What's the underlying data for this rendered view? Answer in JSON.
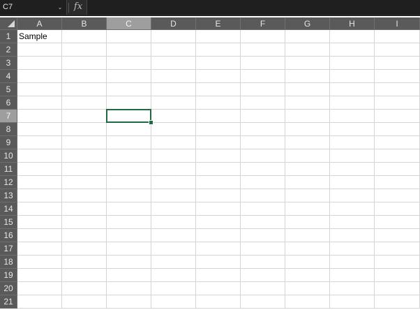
{
  "name_box": {
    "value": "C7",
    "dropdown_glyph": "⌄"
  },
  "formula_bar": {
    "fx_label": "fx",
    "value": ""
  },
  "columns": [
    "A",
    "B",
    "C",
    "D",
    "E",
    "F",
    "G",
    "H",
    "I"
  ],
  "rows": [
    "1",
    "2",
    "3",
    "4",
    "5",
    "6",
    "7",
    "8",
    "9",
    "10",
    "11",
    "12",
    "13",
    "14",
    "15",
    "16",
    "17",
    "18",
    "19",
    "20",
    "21"
  ],
  "cells": {
    "A1": "Sample"
  },
  "selection": {
    "column": "C",
    "row": "7"
  },
  "colors": {
    "header_bg": "#5a5a5a",
    "header_selected_bg": "#9e9e9e",
    "gridline": "#d4d4d4",
    "active_border": "#1e6b41",
    "formula_bar_bg": "#2b2b2b"
  }
}
